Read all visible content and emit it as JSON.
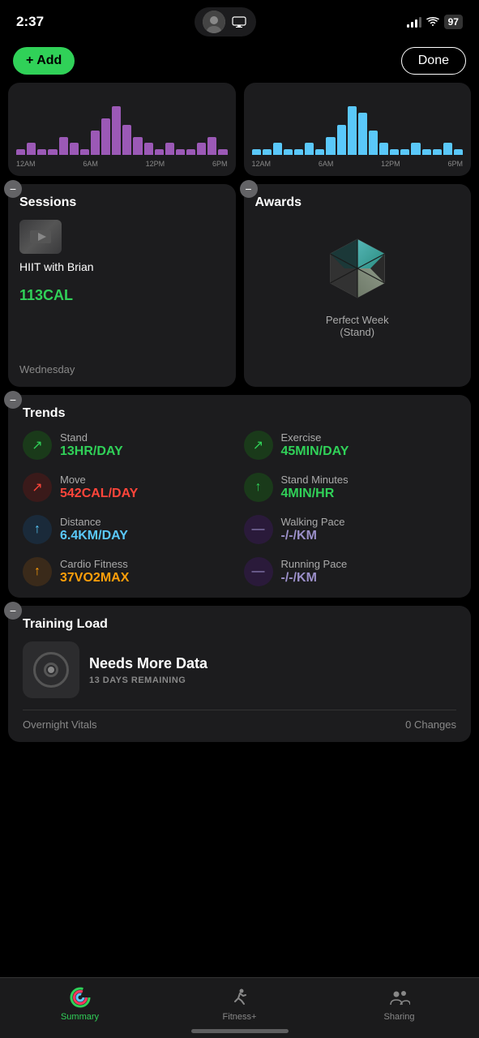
{
  "statusBar": {
    "time": "2:37",
    "batteryLevel": "97"
  },
  "topBar": {
    "addLabel": "+ Add",
    "doneLabel": "Done"
  },
  "sessions": {
    "cardTitle": "Sessions",
    "workoutName": "HIIT with Brian",
    "calories": "113",
    "caloriesUnit": "CAL",
    "day": "Wednesday"
  },
  "awards": {
    "cardTitle": "Awards",
    "awardName": "Perfect Week",
    "awardSubName": "(Stand)"
  },
  "trends": {
    "cardTitle": "Trends",
    "items": [
      {
        "label": "Stand",
        "value": "13HR/DAY",
        "color": "green",
        "arrowType": "up-right"
      },
      {
        "label": "Exercise",
        "value": "45MIN/DAY",
        "color": "green",
        "arrowType": "up-right"
      },
      {
        "label": "Move",
        "value": "542CAL/DAY",
        "color": "red",
        "arrowType": "up-right"
      },
      {
        "label": "Stand Minutes",
        "value": "4MIN/HR",
        "color": "green",
        "arrowType": "up"
      },
      {
        "label": "Distance",
        "value": "6.4KM/DAY",
        "color": "blue",
        "arrowType": "up"
      },
      {
        "label": "Walking Pace",
        "value": "-/-/KM",
        "color": "purple-dim",
        "arrowType": "dash"
      },
      {
        "label": "Cardio Fitness",
        "value": "37VO2MAX",
        "color": "orange",
        "arrowType": "up"
      },
      {
        "label": "Running Pace",
        "value": "-/-/KM",
        "color": "purple-dim",
        "arrowType": "dash"
      }
    ]
  },
  "trainingLoad": {
    "cardTitle": "Training Load",
    "status": "Needs More Data",
    "daysRemaining": "13 DAYS REMAINING",
    "footerLeft": "Overnight Vitals",
    "footerRight": "0 Changes"
  },
  "tabBar": {
    "tabs": [
      {
        "label": "Summary",
        "active": true,
        "iconType": "activity-rings"
      },
      {
        "label": "Fitness+",
        "active": false,
        "iconType": "runner"
      },
      {
        "label": "Sharing",
        "active": false,
        "iconType": "people"
      }
    ]
  },
  "charts": {
    "left": {
      "timeLabels": [
        "12AM",
        "6AM",
        "12PM",
        "6PM"
      ],
      "bars": [
        1,
        2,
        1,
        1,
        3,
        2,
        1,
        4,
        6,
        8,
        5,
        3,
        2,
        1,
        2,
        1,
        1,
        2,
        3,
        1
      ]
    },
    "right": {
      "timeLabels": [
        "12AM",
        "6AM",
        "12PM",
        "6PM"
      ],
      "bars": [
        1,
        1,
        2,
        1,
        1,
        2,
        1,
        3,
        5,
        8,
        7,
        4,
        2,
        1,
        1,
        2,
        1,
        1,
        2,
        1
      ]
    }
  }
}
